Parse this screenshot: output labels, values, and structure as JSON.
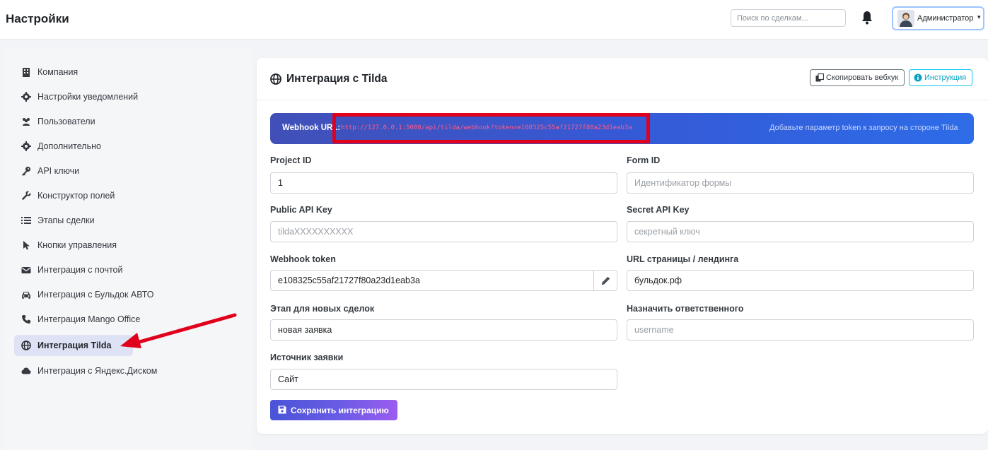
{
  "header": {
    "title": "Настройки",
    "search_placeholder": "Поиск по сделкам...",
    "user_name": "Администратор",
    "user_caret": "▾"
  },
  "sidebar": {
    "items": [
      {
        "label": "Компания",
        "icon": "building-icon"
      },
      {
        "label": "Настройки уведомлений",
        "icon": "gear-icon"
      },
      {
        "label": "Пользователи",
        "icon": "users-icon"
      },
      {
        "label": "Дополнительно",
        "icon": "gear-icon"
      },
      {
        "label": "API ключи",
        "icon": "key-icon"
      },
      {
        "label": "Конструктор полей",
        "icon": "wrench-icon"
      },
      {
        "label": "Этапы сделки",
        "icon": "list-icon"
      },
      {
        "label": "Кнопки управления",
        "icon": "pointer-icon"
      },
      {
        "label": "Интеграция с почтой",
        "icon": "envelope-icon"
      },
      {
        "label": "Интеграция с Бульдок АВТО",
        "icon": "car-icon"
      },
      {
        "label": "Интеграция Mango Office",
        "icon": "phone-icon"
      },
      {
        "label": "Интеграция Tilda",
        "icon": "globe-icon",
        "active": true
      },
      {
        "label": "Интеграция с Яндекс.Диском",
        "icon": "cloud-icon"
      }
    ]
  },
  "card": {
    "title": "Интеграция с Tilda",
    "copy_button": "Скопировать вебхук",
    "help_button": "Инструкция"
  },
  "webhook": {
    "label": "Webhook URL:",
    "url": "http://127.0.0.1:5000/api/tilda/webhook?token=e108325c55af21727f80a23d1eab3a",
    "hint": "Добавьте параметр token к запросу на стороне Tilda"
  },
  "form": {
    "project_id": {
      "label": "Project ID",
      "value": "1",
      "placeholder": ""
    },
    "form_id": {
      "label": "Form ID",
      "value": "",
      "placeholder": "Идентификатор формы"
    },
    "public_key": {
      "label": "Public API Key",
      "value": "",
      "placeholder": "tildaXXXXXXXXXX"
    },
    "secret_key": {
      "label": "Secret API Key",
      "value": "",
      "placeholder": "секретный ключ"
    },
    "webhook_token": {
      "label": "Webhook token",
      "value": "e108325c55af21727f80a23d1eab3a",
      "placeholder": ""
    },
    "landing_url": {
      "label": "URL страницы / лендинга",
      "value": "бульдок.рф",
      "placeholder": ""
    },
    "stage": {
      "label": "Этап для новых сделок",
      "value": "новая заявка",
      "placeholder": ""
    },
    "responsible": {
      "label": "Назначить ответственного",
      "value": "",
      "placeholder": "username"
    },
    "source": {
      "label": "Источник заявки",
      "value": "Сайт",
      "placeholder": ""
    },
    "save_button": "Сохранить интеграцию"
  },
  "colors": {
    "accent": "#3559d6",
    "highlight_box": "#e0001b",
    "arrow": "#e0001b",
    "active_nav": "#dde3f5"
  }
}
